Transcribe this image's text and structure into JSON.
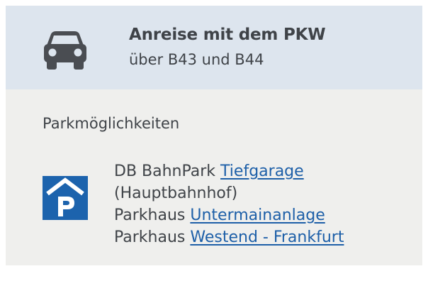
{
  "header": {
    "icon": "car-icon",
    "title": "Anreise mit dem PKW",
    "subtitle": "über B43 und B44"
  },
  "parking": {
    "section_title": "Parkmöglichkeiten",
    "icon": "parking-garage-icon",
    "entries": [
      {
        "prefix": "DB BahnPark",
        "link": "Tiefgarage",
        "suffix": "(Hauptbahnhof)"
      },
      {
        "prefix": "Parkhaus",
        "link": "Untermainanlage"
      },
      {
        "prefix": "Parkhaus",
        "link": "Westend - Frankfurt"
      }
    ]
  },
  "colors": {
    "header_bg": "#dde5ee",
    "card_bg": "#efefed",
    "text": "#3f4348",
    "link": "#1d5fa8",
    "parking_icon_bg": "#1c63ad"
  }
}
